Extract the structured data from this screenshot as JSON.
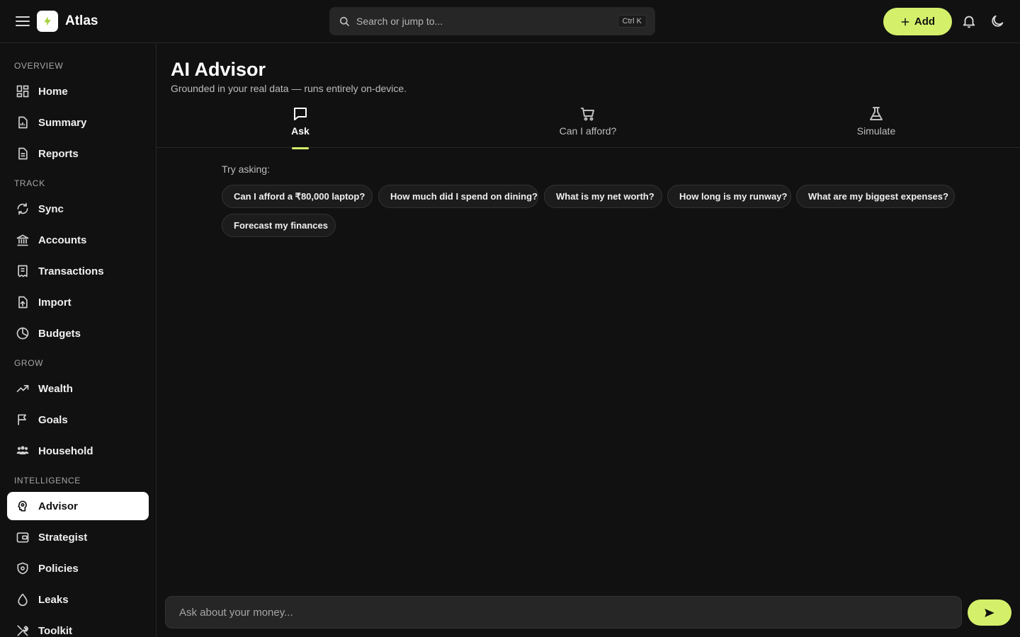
{
  "app": {
    "brand": "Atlas"
  },
  "search": {
    "placeholder": "Search or jump to...",
    "shortcut": "Ctrl K"
  },
  "topbar": {
    "add_label": "Add",
    "accent_color": "#d4f06b"
  },
  "sidebar": {
    "sections": [
      {
        "label": "OVERVIEW",
        "items": [
          {
            "label": "Home",
            "icon": "grid-icon"
          },
          {
            "label": "Summary",
            "icon": "document-chart-icon"
          },
          {
            "label": "Reports",
            "icon": "document-icon"
          }
        ]
      },
      {
        "label": "TRACK",
        "items": [
          {
            "label": "Sync",
            "icon": "sync-icon"
          },
          {
            "label": "Accounts",
            "icon": "bank-icon"
          },
          {
            "label": "Transactions",
            "icon": "receipt-icon"
          },
          {
            "label": "Import",
            "icon": "file-upload-icon"
          },
          {
            "label": "Budgets",
            "icon": "pie-chart-icon"
          }
        ]
      },
      {
        "label": "GROW",
        "items": [
          {
            "label": "Wealth",
            "icon": "trending-up-icon"
          },
          {
            "label": "Goals",
            "icon": "flag-icon"
          },
          {
            "label": "Household",
            "icon": "people-icon"
          }
        ]
      },
      {
        "label": "INTELLIGENCE",
        "items": [
          {
            "label": "Advisor",
            "icon": "brain-icon",
            "active": true
          },
          {
            "label": "Strategist",
            "icon": "wallet-icon"
          },
          {
            "label": "Policies",
            "icon": "shield-icon"
          },
          {
            "label": "Leaks",
            "icon": "drop-icon"
          },
          {
            "label": "Toolkit",
            "icon": "tools-icon"
          }
        ]
      }
    ]
  },
  "main": {
    "title": "AI Advisor",
    "subtitle": "Grounded in your real data — runs entirely on-device.",
    "tabs": [
      {
        "label": "Ask",
        "icon": "chat-icon",
        "active": true
      },
      {
        "label": "Can I afford?",
        "icon": "cart-icon"
      },
      {
        "label": "Simulate",
        "icon": "flask-icon"
      }
    ],
    "try_label": "Try asking:",
    "suggestions": [
      "Can I afford a ₹80,000 laptop?",
      "How much did I spend on dining?",
      "What is my net worth?",
      "How long is my runway?",
      "What are my biggest expenses?",
      "Forecast my finances"
    ],
    "input_placeholder": "Ask about your money..."
  }
}
